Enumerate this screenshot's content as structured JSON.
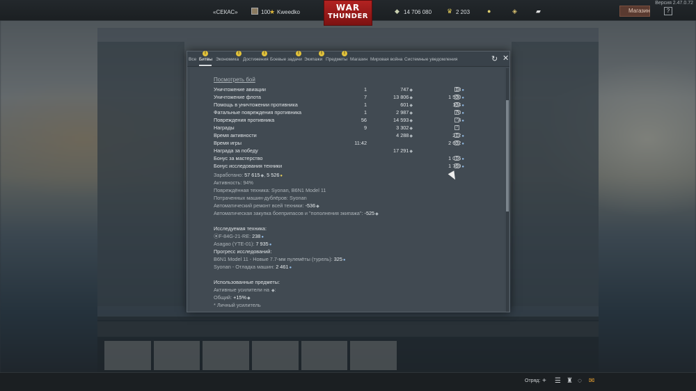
{
  "topbar": {
    "version": "Версия 2.47.0.72",
    "squadron": "«СЕКАС»",
    "level": "100",
    "nickname": "Kweedko",
    "logo_line1": "WAR",
    "logo_line2": "THUNDER",
    "silver_lions": "14 706 080",
    "golden_eagles": "2 203",
    "shop_label": "Магазин",
    "help_label": "?"
  },
  "tabs": [
    {
      "label": "Все",
      "active": false
    },
    {
      "label": "Битвы",
      "active": true,
      "badge": "!"
    },
    {
      "label": "Экономика",
      "active": false
    },
    {
      "label": "Достижения",
      "active": false,
      "badge": "!"
    },
    {
      "label": "Боевые задачи",
      "active": false,
      "badge": "!"
    },
    {
      "label": "Экипажи",
      "active": false,
      "badge": "!"
    },
    {
      "label": "Предметы",
      "active": false,
      "badge": "!"
    },
    {
      "label": "Магазин",
      "active": false,
      "badge": "!"
    },
    {
      "label": "Мировая война",
      "active": false
    },
    {
      "label": "Системные уведомления",
      "active": false
    }
  ],
  "report": {
    "view_battle": "Посмотреть бой",
    "rows": [
      {
        "name": "Уничтожение авиации",
        "count": "1",
        "sl": "747",
        "rp": "18"
      },
      {
        "name": "Уничтожение флота",
        "count": "7",
        "sl": "13 806",
        "rp": "1 500"
      },
      {
        "name": "Помощь в уничтожении противника",
        "count": "1",
        "sl": "601",
        "rp": "104"
      },
      {
        "name": "Фатальные повреждения противника",
        "count": "1",
        "sl": "2 987",
        "rp": "70"
      },
      {
        "name": "Повреждения противника",
        "count": "56",
        "sl": "14 593",
        "rp": "4"
      },
      {
        "name": "Награды",
        "count": "9",
        "sl": "3 302",
        "rp": ""
      },
      {
        "name": "Время активности",
        "count": "",
        "sl": "4 288",
        "rp": "212"
      },
      {
        "name": "Время игры",
        "count": "11:42",
        "sl": "",
        "rp": "2 602"
      },
      {
        "name": "Награда за победу",
        "count": "",
        "sl": "17 291",
        "rp": ""
      },
      {
        "name": "Бонус за мастерство",
        "count": "",
        "sl": "",
        "rp": "1 016"
      },
      {
        "name": "Бонус исследования техники",
        "count": "",
        "sl": "",
        "rp": "1 769"
      }
    ],
    "earned_label": "Заработано:",
    "earned_sl": "57 615",
    "earned_rp": "5 526",
    "activity_label": "Активность:",
    "activity": "94%",
    "damaged_label": "Повреждённая техника:",
    "damaged": "Syonan, B6N1 Model 11",
    "backup_label": "Потраченных машин-дублёров:",
    "backup": "Syonan",
    "repair_label": "Автоматический ремонт всей техники:",
    "repair": "-536",
    "ammo_label": "Автоматическая закупка боеприпасов и \"пополнения экипажа\":",
    "ammo": "-525",
    "research_title": "Исследуемая техника:",
    "research_1_name": "F-84G-21-RE:",
    "research_1_val": "238",
    "research_2_name": "Asagao (YTE-01):",
    "research_2_val": "7 935",
    "progress_title": "Прогресс исследований:",
    "progress_1_name": "B6N1 Model 11 - Новые 7.7-мм пулемёты (турель):",
    "progress_1_val": "325",
    "progress_2_name": "Syonan - Отладка машин:",
    "progress_2_val": "2 461",
    "items_title": "Использованные предметы:",
    "boosters_label": "Активные усилители на",
    "general_label": "Общий:",
    "general_val": "+15%",
    "personal_label": "* Личный усилитель"
  },
  "bottombar": {
    "squad_label": "Отряд:"
  },
  "colors": {
    "modal_bg": "#3f4850",
    "accent_badge": "#e2c23a",
    "logo_red": "#b32221"
  }
}
